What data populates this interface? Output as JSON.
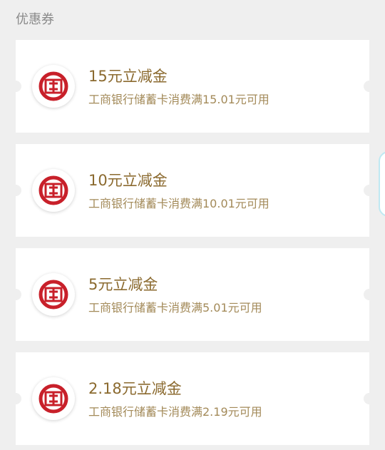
{
  "header": {
    "title": "优惠券"
  },
  "coupons": [
    {
      "title": "15元立减金",
      "description": "工商银行储蓄卡消费满15.01元可用",
      "icon": "icbc-logo-icon"
    },
    {
      "title": "10元立减金",
      "description": "工商银行储蓄卡消费满10.01元可用",
      "icon": "icbc-logo-icon"
    },
    {
      "title": "5元立减金",
      "description": "工商银行储蓄卡消费满5.01元可用",
      "icon": "icbc-logo-icon"
    },
    {
      "title": "2.18元立减金",
      "description": "工商银行储蓄卡消费满2.19元可用",
      "icon": "icbc-logo-icon"
    }
  ],
  "colors": {
    "background": "#efefef",
    "title_gold": "#8b6a2f",
    "desc_gold": "#a38a59",
    "logo_red": "#c8202a"
  }
}
